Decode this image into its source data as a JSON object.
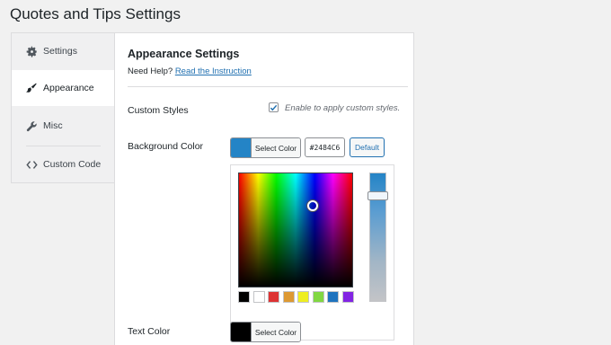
{
  "page": {
    "title": "Quotes and Tips Settings"
  },
  "tabs": [
    {
      "label": "Settings",
      "icon": "gear-icon"
    },
    {
      "label": "Appearance",
      "icon": "paintbrush-icon"
    },
    {
      "label": "Misc",
      "icon": "wrench-icon"
    },
    {
      "label": "Custom Code",
      "icon": "code-icon"
    }
  ],
  "panel": {
    "title": "Appearance Settings",
    "help_prefix": "Need Help?",
    "help_link": "Read the Instruction"
  },
  "custom_styles": {
    "label": "Custom Styles",
    "checked": true,
    "description": "Enable to apply custom styles."
  },
  "background_color": {
    "label": "Background Color",
    "button_label": "Select Color",
    "hex_value": "#2484C6",
    "default_label": "Default",
    "swatch": "#2484c6",
    "palette": [
      "#000000",
      "#ffffff",
      "#dd3333",
      "#dd9933",
      "#eeee22",
      "#81d742",
      "#1e73be",
      "#8224e3"
    ]
  },
  "text_color": {
    "label": "Text Color",
    "button_label": "Select Color",
    "swatch": "#000000"
  }
}
